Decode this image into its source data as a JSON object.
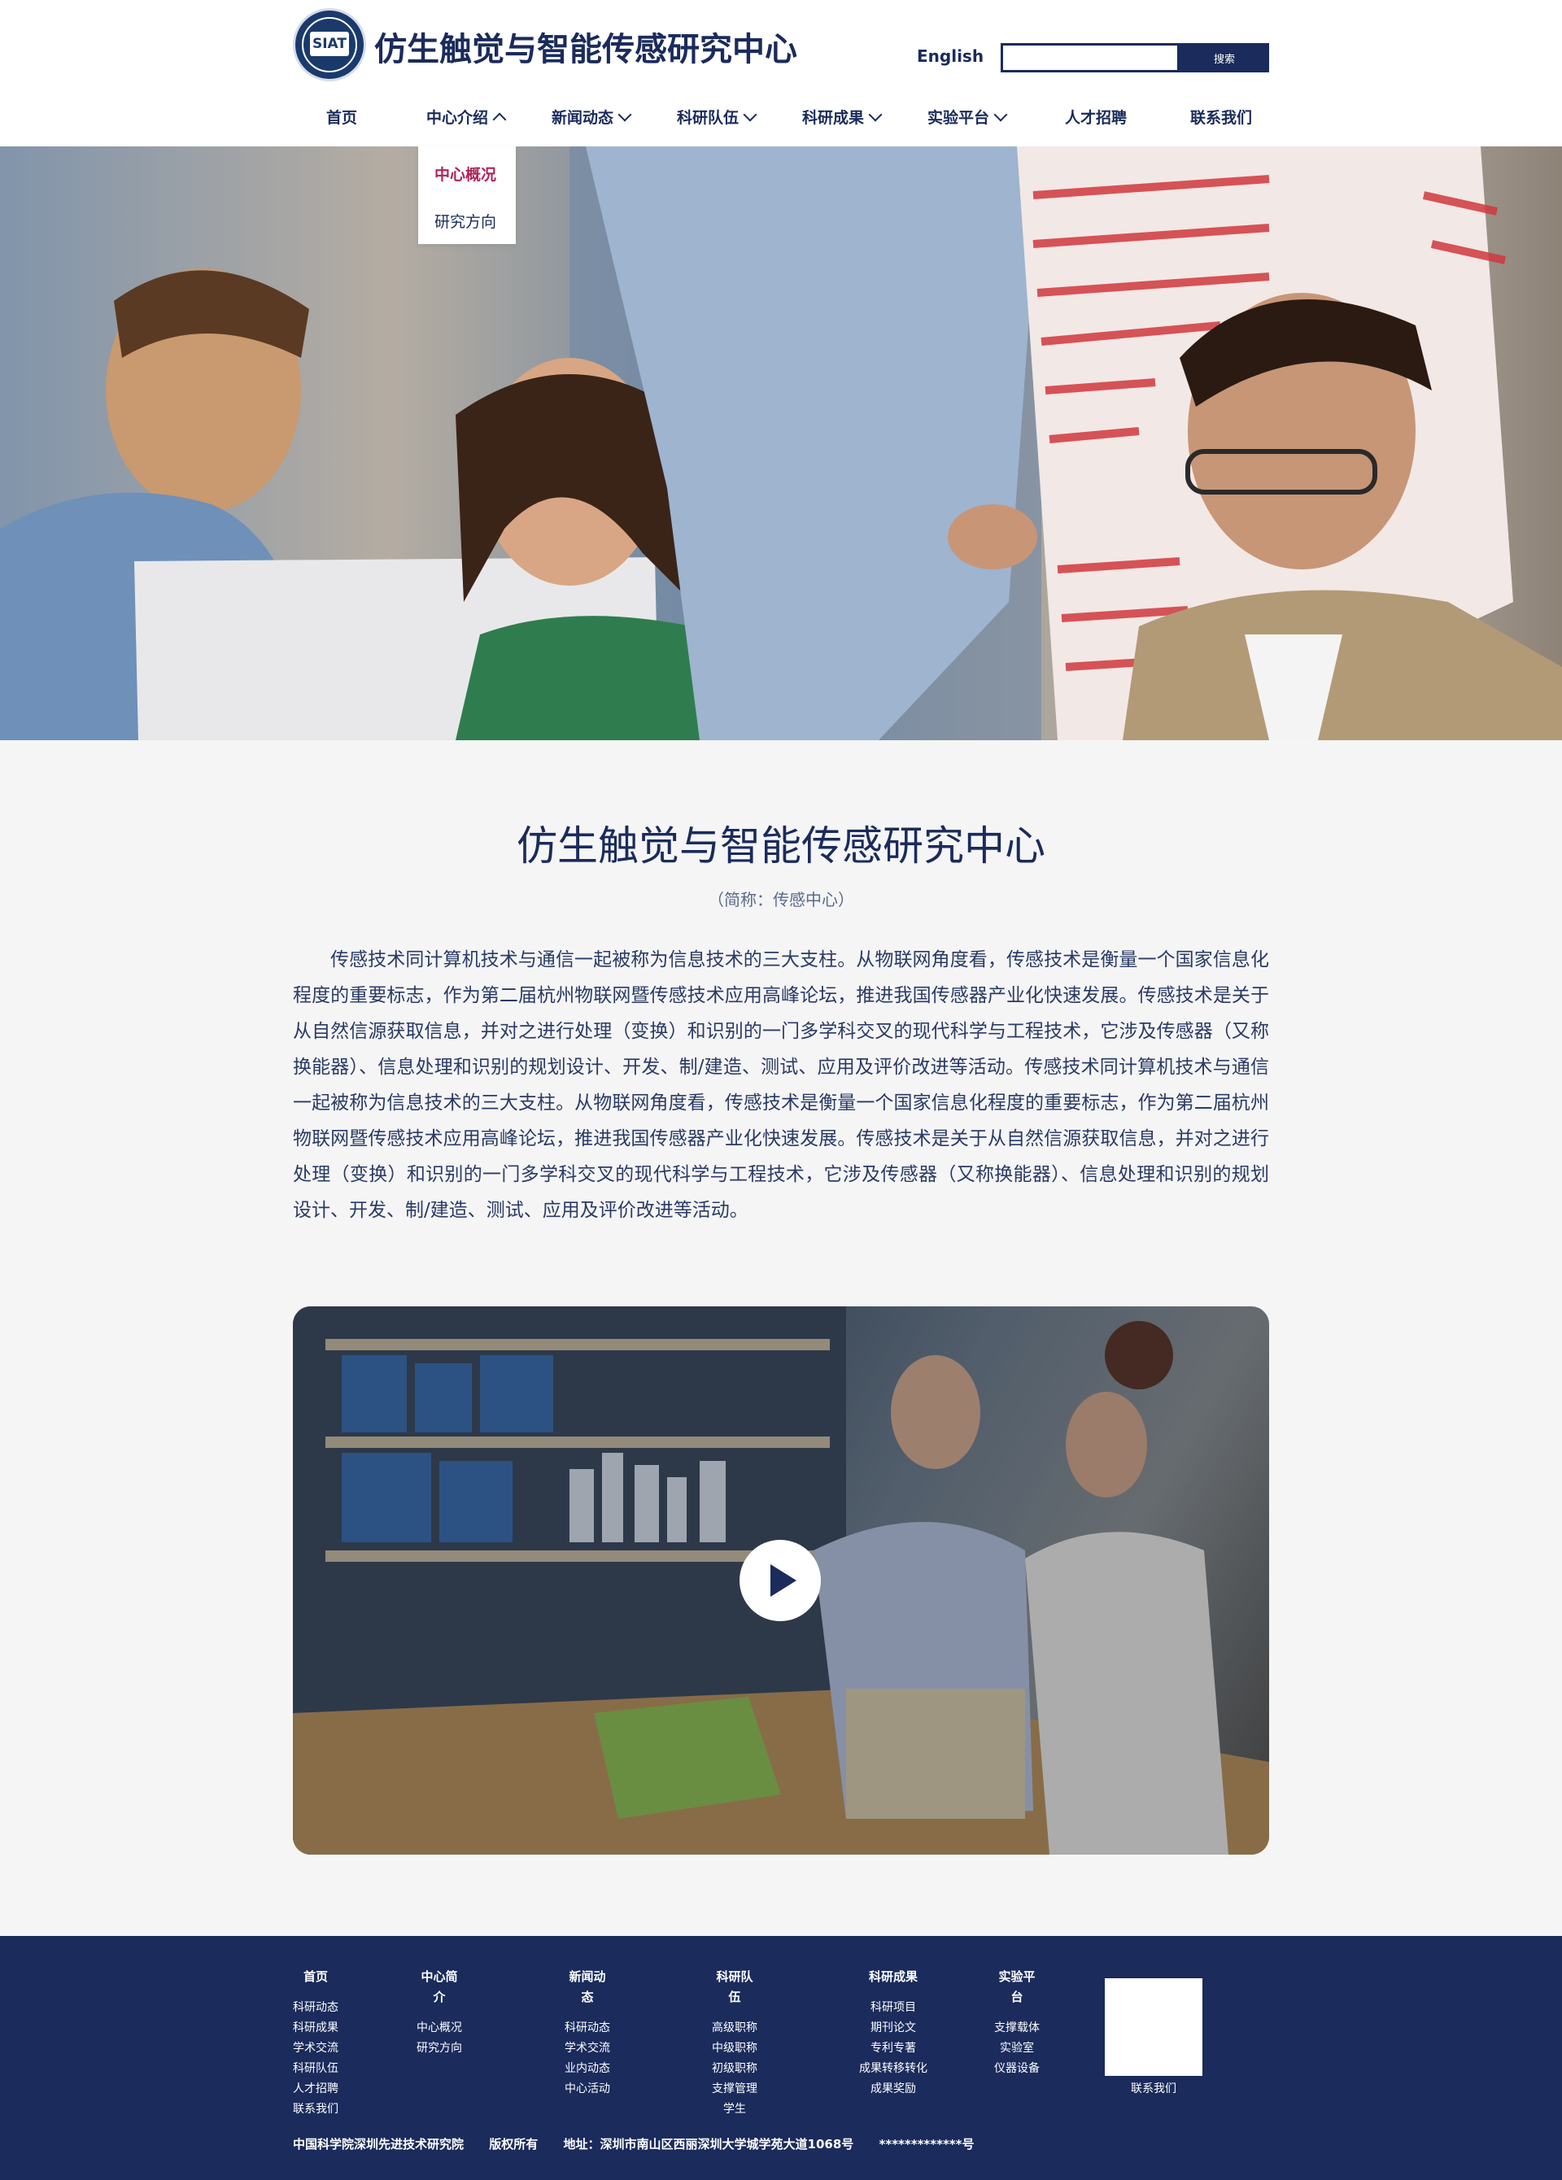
{
  "header": {
    "logo_text": "SIAT",
    "site_title": "仿生触觉与智能传感研究中心",
    "lang_link": "English",
    "search_placeholder": "",
    "search_button": "搜索"
  },
  "nav": [
    {
      "label": "首页"
    },
    {
      "label": "中心介绍"
    },
    {
      "label": "新闻动态"
    },
    {
      "label": "科研队伍"
    },
    {
      "label": "科研成果"
    },
    {
      "label": "实验平台"
    },
    {
      "label": "人才招聘"
    },
    {
      "label": "联系我们"
    }
  ],
  "dropdown": {
    "active": "中心概况",
    "item": "研究方向"
  },
  "hero": {
    "slide_count": 5,
    "active_slide": 1
  },
  "intro": {
    "title": "仿生触觉与智能传感研究中心",
    "subtitle": "（简称：传感中心）",
    "body": "传感技术同计算机技术与通信一起被称为信息技术的三大支柱。从物联网角度看，传感技术是衡量一个国家信息化程度的重要标志，作为第二届杭州物联网暨传感技术应用高峰论坛，推进我国传感器产业化快速发展。传感技术是关于从自然信源获取信息，并对之进行处理（变换）和识别的一门多学科交叉的现代科学与工程技术，它涉及传感器（又称换能器）、信息处理和识别的规划设计、开发、制/建造、测试、应用及评价改进等活动。传感技术同计算机技术与通信一起被称为信息技术的三大支柱。从物联网角度看，传感技术是衡量一个国家信息化程度的重要标志，作为第二届杭州物联网暨传感技术应用高峰论坛，推进我国传感器产业化快速发展。传感技术是关于从自然信源获取信息，并对之进行处理（变换）和识别的一门多学科交叉的现代科学与工程技术，它涉及传感器（又称换能器）、信息处理和识别的规划设计、开发、制/建造、测试、应用及评价改进等活动。"
  },
  "footer": {
    "columns": [
      {
        "title": "首页",
        "links": [
          "科研动态",
          "科研成果",
          "学术交流",
          "科研队伍",
          "人才招聘",
          "联系我们"
        ]
      },
      {
        "title": "中心简介",
        "links": [
          "中心概况",
          "研究方向"
        ]
      },
      {
        "title": "新闻动态",
        "links": [
          "科研动态",
          "学术交流",
          "业内动态",
          "中心活动"
        ]
      },
      {
        "title": "科研队伍",
        "links": [
          "高级职称",
          "中级职称",
          "初级职称",
          "支撑管理",
          "学生"
        ]
      },
      {
        "title": "科研成果",
        "links": [
          "科研项目",
          "期刊论文",
          "专利专著",
          "成果转移转化",
          "成果奖励"
        ]
      },
      {
        "title": "实验平台",
        "links": [
          "支撑载体",
          "实验室",
          "仪器设备"
        ]
      }
    ],
    "qr_label": "联系我们",
    "copyright": {
      "org": "中国科学院深圳先进技术研究院",
      "rights": "版权所有",
      "address": "地址：深圳市南山区西丽深圳大学城学苑大道1068号",
      "icp": "*************号"
    }
  }
}
